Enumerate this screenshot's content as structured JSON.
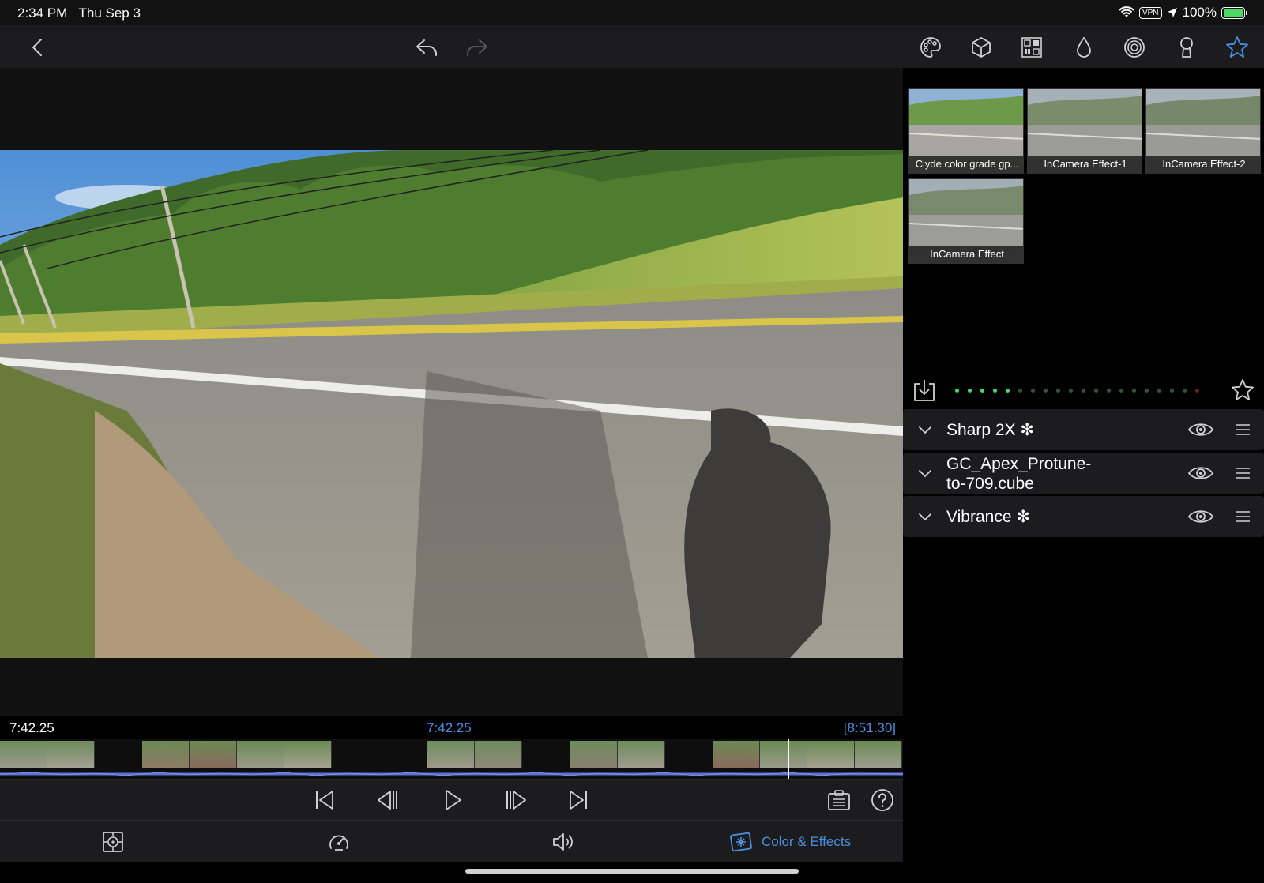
{
  "status_bar": {
    "time": "2:34 PM",
    "date": "Thu Sep 3",
    "vpn": "VPN",
    "battery": "100%",
    "battery_level": 1.0
  },
  "nav": {
    "icons": [
      "back-chevron-icon",
      "undo-icon",
      "redo-icon",
      "palette-icon",
      "cube-icon",
      "lut-grid-icon",
      "drop-icon",
      "spiral-icon",
      "keyhole-icon",
      "star-icon"
    ]
  },
  "timeline": {
    "current_left": "7:42.25",
    "current_center": "7:42.25",
    "total": "[8:51.30]",
    "playhead_fraction": 0.872
  },
  "tabs": {
    "color_effects_label": "Color & Effects"
  },
  "presets": [
    {
      "label": "Clyde color grade gp..."
    },
    {
      "label": "InCamera Effect-1"
    },
    {
      "label": "InCamera Effect-2"
    },
    {
      "label": "InCamera Effect"
    }
  ],
  "effects": [
    {
      "name": "Sharp 2X ✻"
    },
    {
      "name": "GC_Apex_Protune-to-709.cube",
      "line1": "GC_Apex_Protune-",
      "line2": "to-709.cube"
    },
    {
      "name": "Vibrance ✻"
    }
  ],
  "colors": {
    "accent": "#4a90e2",
    "dot_active": "#4cd964",
    "dot_inactive": "#2e5a2e",
    "dot_end": "#6b1f1f"
  }
}
